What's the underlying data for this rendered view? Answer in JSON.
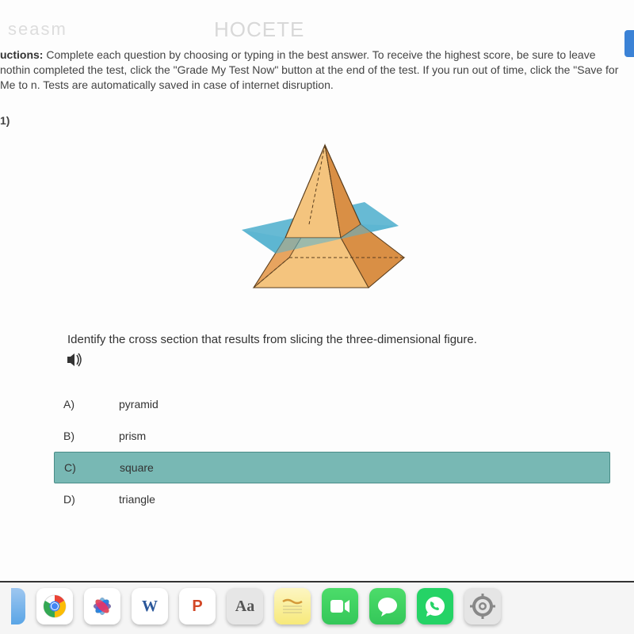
{
  "watermark_a": "seasm",
  "watermark_b": "HOCETE",
  "instructions_label": "uctions:",
  "instructions_text": " Complete each question by choosing or typing in the best answer. To receive the highest score, be sure to leave nothin completed the test, click the \"Grade My Test Now\" button at the end of the test. If you run out of time, click the \"Save for Me to n. Tests are automatically saved in case of internet disruption.",
  "question_number": "1)",
  "question_prompt": "Identify the cross section that results from slicing the three-dimensional figure.",
  "answers": {
    "a": {
      "letter": "A)",
      "text": "pyramid"
    },
    "b": {
      "letter": "B)",
      "text": "prism"
    },
    "c": {
      "letter": "C)",
      "text": "square"
    },
    "d": {
      "letter": "D)",
      "text": "triangle"
    }
  },
  "selected": "c",
  "dock": {
    "word": "W",
    "ppt": "P",
    "dict": "Aa"
  }
}
